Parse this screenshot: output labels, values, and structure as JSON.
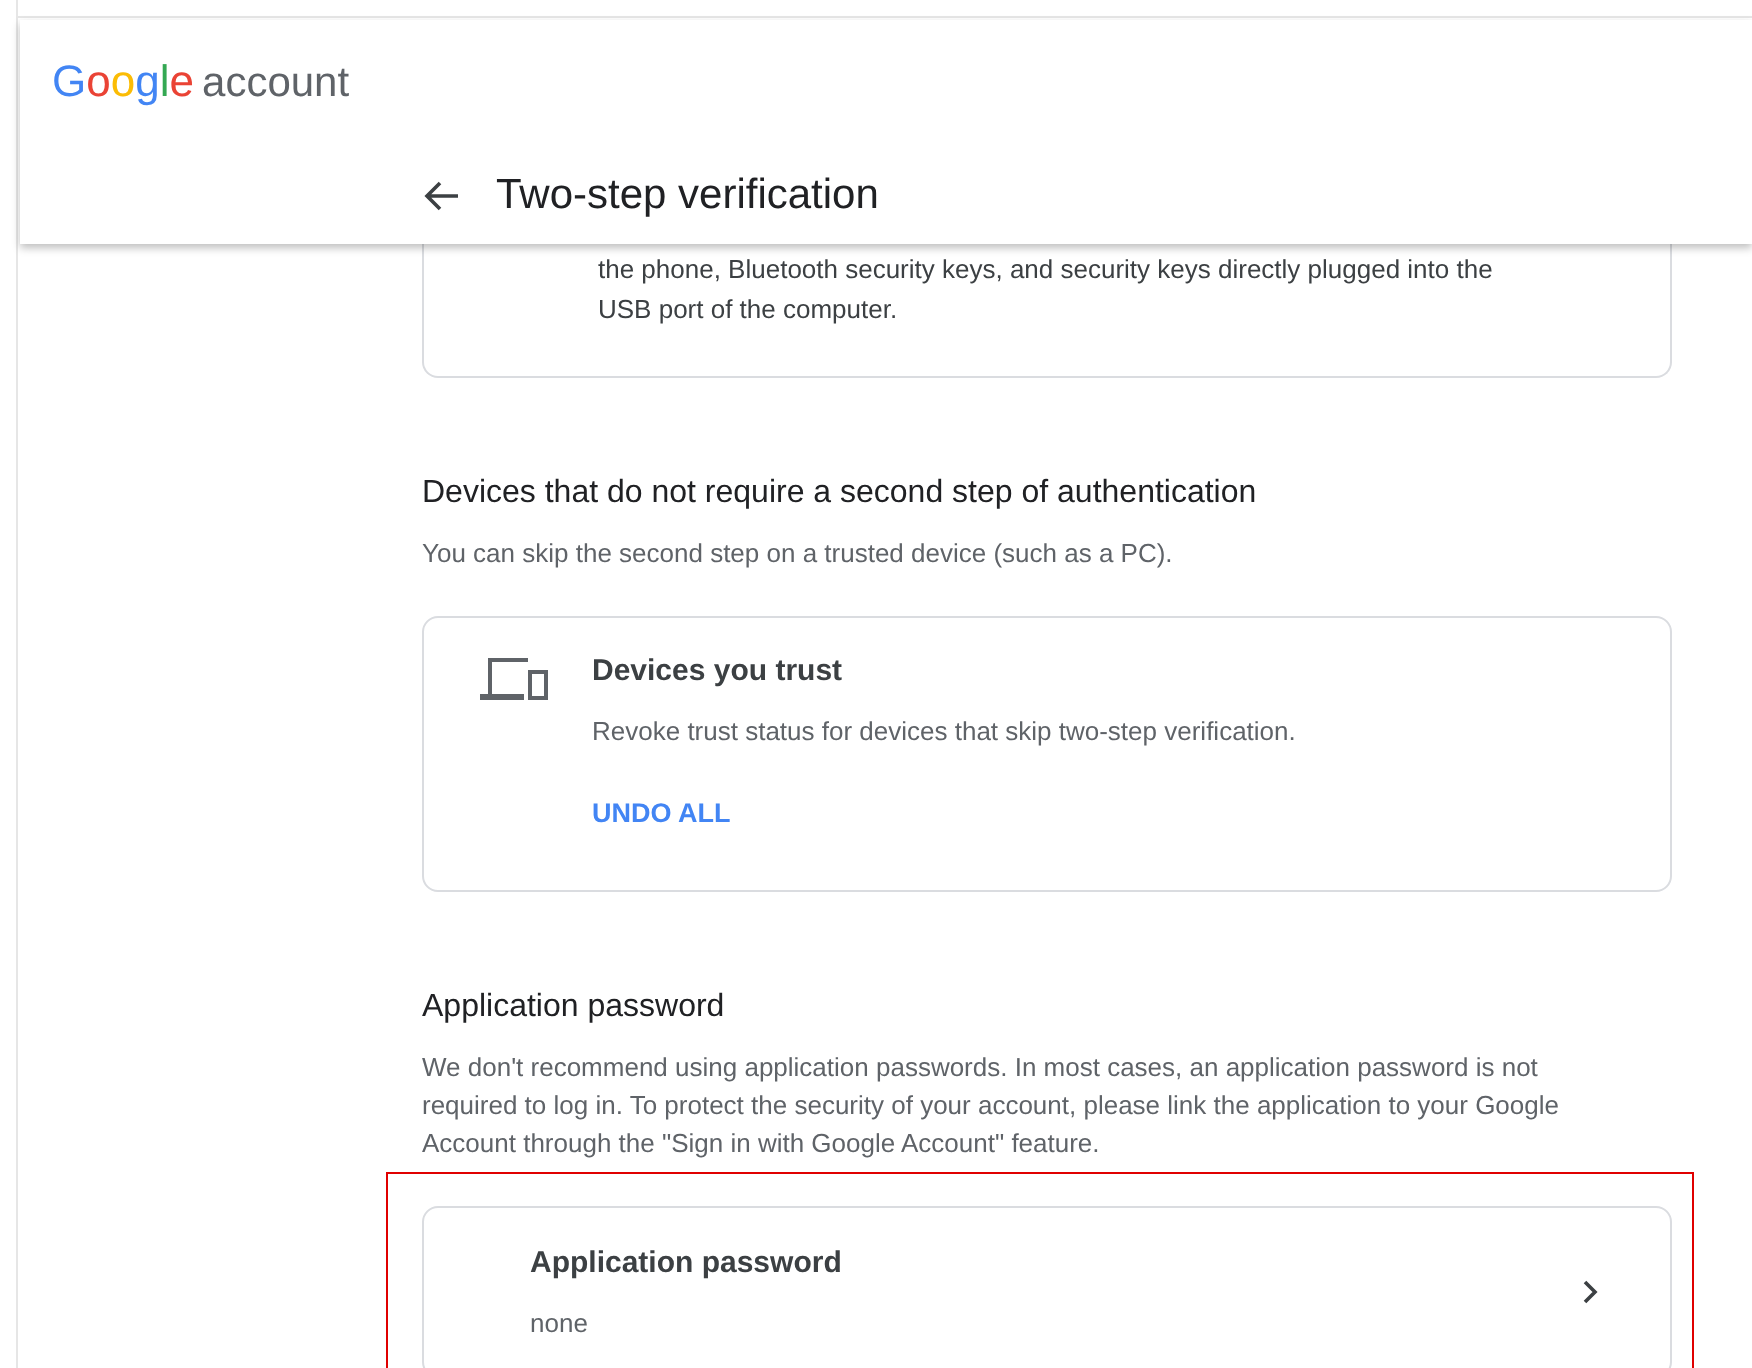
{
  "header": {
    "logo": {
      "brand": "Google",
      "product": "account"
    },
    "title": "Two-step verification"
  },
  "security_key_card": {
    "lines": [
      "the phone, Bluetooth security keys, and security keys directly plugged into the",
      "USB port of the computer."
    ]
  },
  "sections": [
    {
      "heading": "Devices that do not require a second step of authentication",
      "description": "You can skip the second step on a trusted device (such as a PC).",
      "card": {
        "kind": "devices",
        "title": "Devices you trust",
        "description": "Revoke trust status for devices that skip two-step verification.",
        "action": "UNDO ALL",
        "highlighted": false
      }
    },
    {
      "heading": "Application password",
      "description": "We don't recommend using application passwords. In most cases, an application password is not required to log in. To protect the security of your account, please link the application to your Google Account through the \"Sign in with Google Account\" feature.",
      "card": {
        "kind": "link",
        "title": "Application password",
        "value": "none",
        "highlighted": true
      }
    }
  ]
}
